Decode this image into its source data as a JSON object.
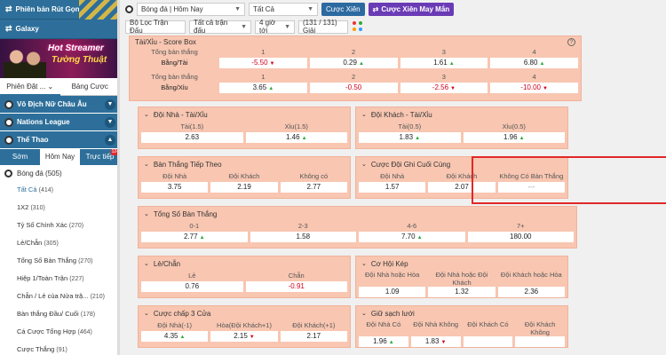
{
  "sidebar": {
    "top1": "Phiên bản Rút Gọn",
    "top2": "Galaxy",
    "banner": {
      "line1": "Hot Streamer",
      "line2": "Tường Thuật"
    },
    "tab1": "Phiên Đặt ...",
    "tab2": "Bảng Cược",
    "leagues": [
      "Vô Địch Nữ Châu Âu",
      "Nations League",
      "Thể Thao"
    ],
    "subtabs": [
      "Sớm",
      "Hôm Nay",
      "Trực tiếp"
    ],
    "live_badge": "124",
    "sport_label": "Bóng đá",
    "sport_count": "(505)",
    "markets": [
      {
        "label": "Tất Cả",
        "count": "(414)"
      },
      {
        "label": "1X2",
        "count": "(310)"
      },
      {
        "label": "Tỷ Số Chính Xác",
        "count": "(270)"
      },
      {
        "label": "Lẻ/Chẵn",
        "count": "(305)"
      },
      {
        "label": "Tổng Số Bàn Thắng",
        "count": "(270)"
      },
      {
        "label": "Hiệp 1/Toàn Trận",
        "count": "(227)"
      },
      {
        "label": "Chẵn / Lẻ của Nửa trậ...",
        "count": "(210)"
      },
      {
        "label": "Bàn thắng Đầu/ Cuối",
        "count": "(178)"
      },
      {
        "label": "Cá Cược Tổng Hợp",
        "count": "(464)"
      },
      {
        "label": "Cược Thắng",
        "count": "(91)"
      }
    ]
  },
  "toolbar": {
    "sport_select": "Bóng đá | Hôm Nay",
    "filter_select": "Tất Cả",
    "btn_xien": "Cược Xiên",
    "btn_may_man": "Cược Xiên May Mắn",
    "league_filter": "Bộ Lọc Trận Đấu",
    "all_matches": "Tất cả trận đấu",
    "time_select": "4 giờ tới",
    "count_select": "(131 / 131) Giải"
  },
  "panels": {
    "score_box": {
      "title": "Tài/Xỉu - Score Box",
      "rows": [
        {
          "head": "Tổng bàn thắng",
          "cols": [
            "1",
            "2",
            "3",
            "4"
          ],
          "label": "Bằng/Tài",
          "odds": [
            "-5.50",
            "0.29",
            "1.61",
            "6.80"
          ],
          "dir": [
            "d",
            "u",
            "u",
            "u"
          ]
        },
        {
          "head": "Tổng bàn thắng",
          "cols": [
            "1",
            "2",
            "3",
            "4"
          ],
          "label": "Bằng/Xỉu",
          "odds": [
            "3.65",
            "-0.50",
            "-2.56",
            "-10.00"
          ],
          "dir": [
            "u",
            "",
            "d",
            "d"
          ]
        }
      ]
    },
    "home_ou": {
      "title": "Đội Nhà - Tài/Xỉu",
      "labels": [
        "Tài(1.5)",
        "Xỉu(1.5)"
      ],
      "odds": [
        "2.63",
        "1.46"
      ]
    },
    "away_ou": {
      "title": "Đội Khách - Tài/Xỉu",
      "labels": [
        "Tài(0.5)",
        "Xỉu(0.5)"
      ],
      "odds": [
        "1.83",
        "1.96"
      ]
    },
    "next_goal": {
      "title": "Bàn Thắng Tiếp Theo",
      "labels": [
        "Đội Nhà",
        "Đội Khách",
        "Không có"
      ],
      "odds": [
        "3.75",
        "2.19",
        "2.77"
      ]
    },
    "last_goal": {
      "title": "Cược Đội Ghi Cuối Cùng",
      "labels": [
        "Đội Nhà",
        "Đội Khách",
        "Không Có Bàn Thắng"
      ],
      "odds": [
        "1.57",
        "2.07",
        "---"
      ]
    },
    "total_goals": {
      "title": "Tổng Số Bàn Thắng",
      "labels": [
        "0-1",
        "2-3",
        "4-6",
        "7+"
      ],
      "odds": [
        "2.77",
        "1.58",
        "7.70",
        "180.00"
      ]
    },
    "odd_even": {
      "title": "Lẻ/Chẵn",
      "labels": [
        "Lẻ",
        "Chẵn"
      ],
      "odds": [
        "0.76",
        "-0.91"
      ]
    },
    "double_chance": {
      "title": "Cơ Hội Kép",
      "labels": [
        "Đội Nhà hoặc Hòa",
        "Đội Nhà hoặc Đội Khách",
        "Đội Khách hoặc Hòa"
      ],
      "odds": [
        "1.09",
        "1.32",
        "2.36"
      ]
    },
    "handicap3": {
      "title": "Cược chấp 3 Cửa",
      "labels": [
        "Đội Nhà(-1)",
        "Hòa(Đội Khách+1)",
        "Đội Khách(+1)"
      ],
      "odds": [
        "4.35",
        "2.15",
        "2.17"
      ]
    },
    "clean_sheet": {
      "title": "Giữ sạch lưới",
      "labels": [
        "Đội Nhà Có",
        "Đội Nhà Không",
        "Đội Khách Có",
        "Đội Khách Không"
      ],
      "odds": [
        "1.96",
        "1.83",
        "",
        ""
      ]
    }
  },
  "colors": {
    "sidebar_blue": "#2d6f9a",
    "panel_bg": "#f8c6b1",
    "highlight": "#e02828",
    "purple": "#6a3bb5"
  }
}
